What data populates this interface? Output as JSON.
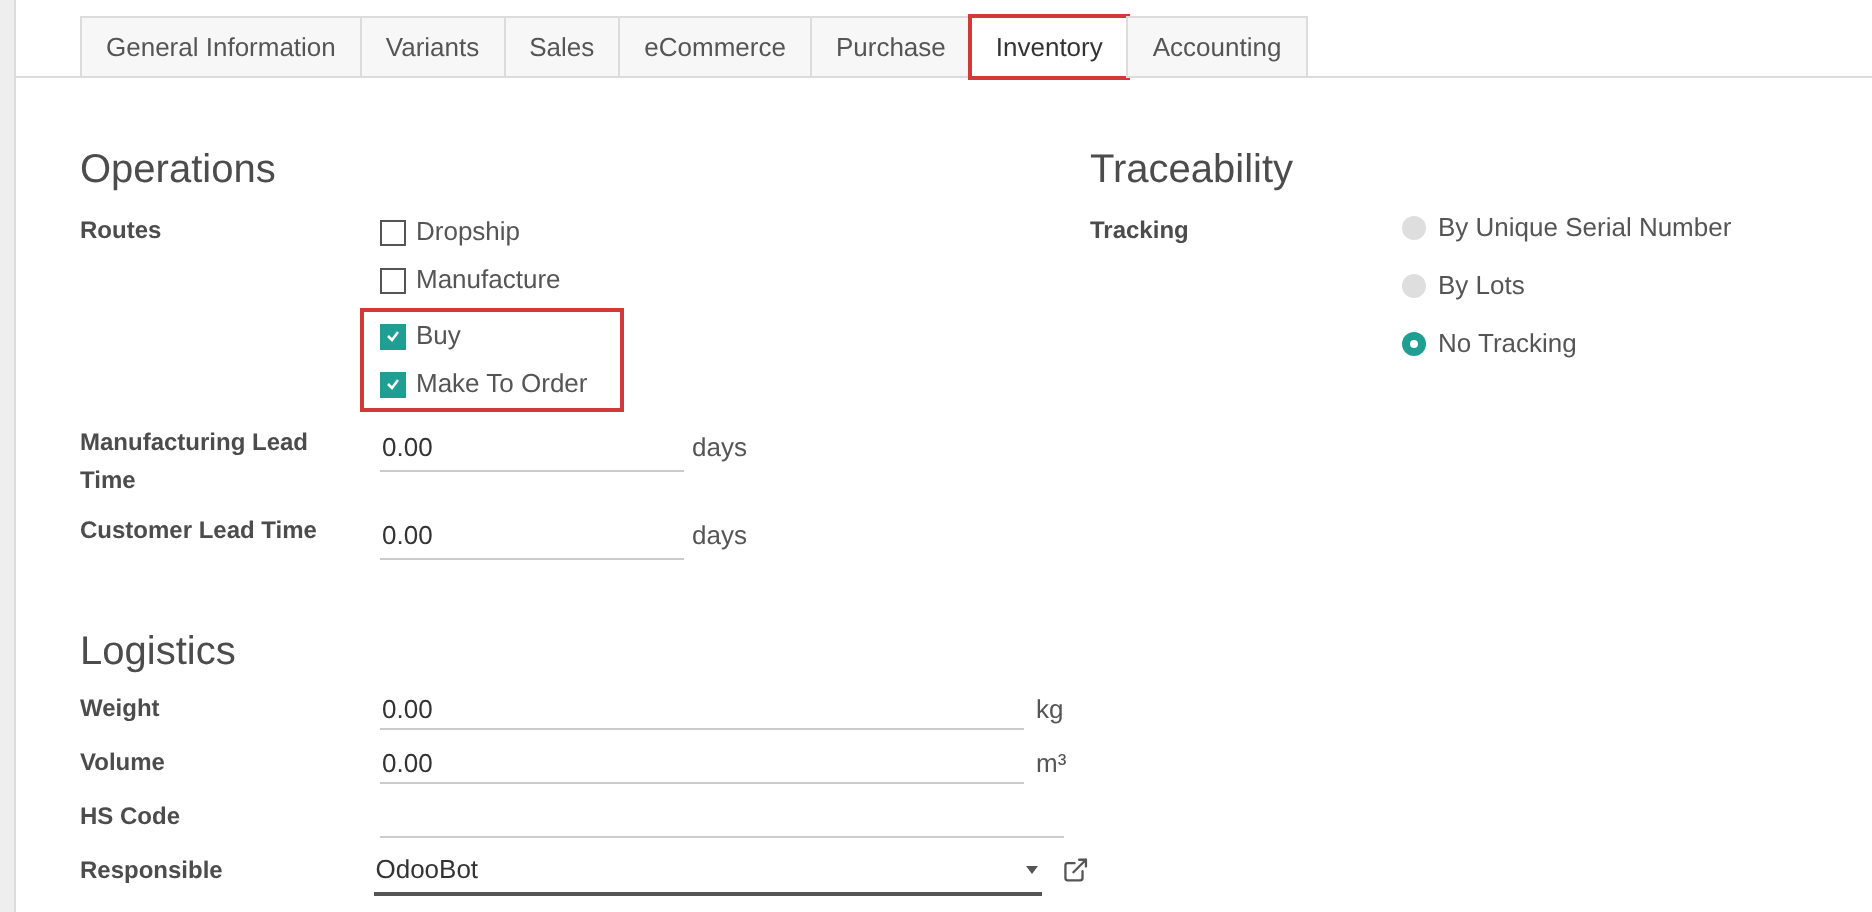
{
  "tabs": [
    {
      "label": "General Information",
      "selected": false,
      "highlighted": false
    },
    {
      "label": "Variants",
      "selected": false,
      "highlighted": false
    },
    {
      "label": "Sales",
      "selected": false,
      "highlighted": false
    },
    {
      "label": "eCommerce",
      "selected": false,
      "highlighted": false
    },
    {
      "label": "Purchase",
      "selected": false,
      "highlighted": false
    },
    {
      "label": "Inventory",
      "selected": true,
      "highlighted": true
    },
    {
      "label": "Accounting",
      "selected": false,
      "highlighted": false
    }
  ],
  "operations": {
    "title": "Operations",
    "routes_label": "Routes",
    "route_groups": [
      {
        "highlighted": false,
        "options": [
          {
            "label": "Dropship",
            "checked": false
          },
          {
            "label": "Manufacture",
            "checked": false
          }
        ]
      },
      {
        "highlighted": true,
        "options": [
          {
            "label": "Buy",
            "checked": true
          },
          {
            "label": "Make To Order",
            "checked": true
          }
        ]
      }
    ],
    "fields": [
      {
        "label": "Manufacturing Lead Time",
        "value": "0.00",
        "unit": "days"
      },
      {
        "label": "Customer Lead Time",
        "value": "0.00",
        "unit": "days"
      }
    ]
  },
  "traceability": {
    "title": "Traceability",
    "tracking_label": "Tracking",
    "options": [
      {
        "label": "By Unique Serial Number",
        "selected": false
      },
      {
        "label": "By Lots",
        "selected": false
      },
      {
        "label": "No Tracking",
        "selected": true
      }
    ]
  },
  "logistics": {
    "title": "Logistics",
    "fields": [
      {
        "kind": "number",
        "label": "Weight",
        "value": "0.00",
        "unit": "kg"
      },
      {
        "kind": "number",
        "label": "Volume",
        "value": "0.00",
        "unit": "m³"
      },
      {
        "kind": "text",
        "label": "HS Code"
      },
      {
        "kind": "select",
        "label": "Responsible",
        "value": "OdooBot"
      }
    ]
  }
}
